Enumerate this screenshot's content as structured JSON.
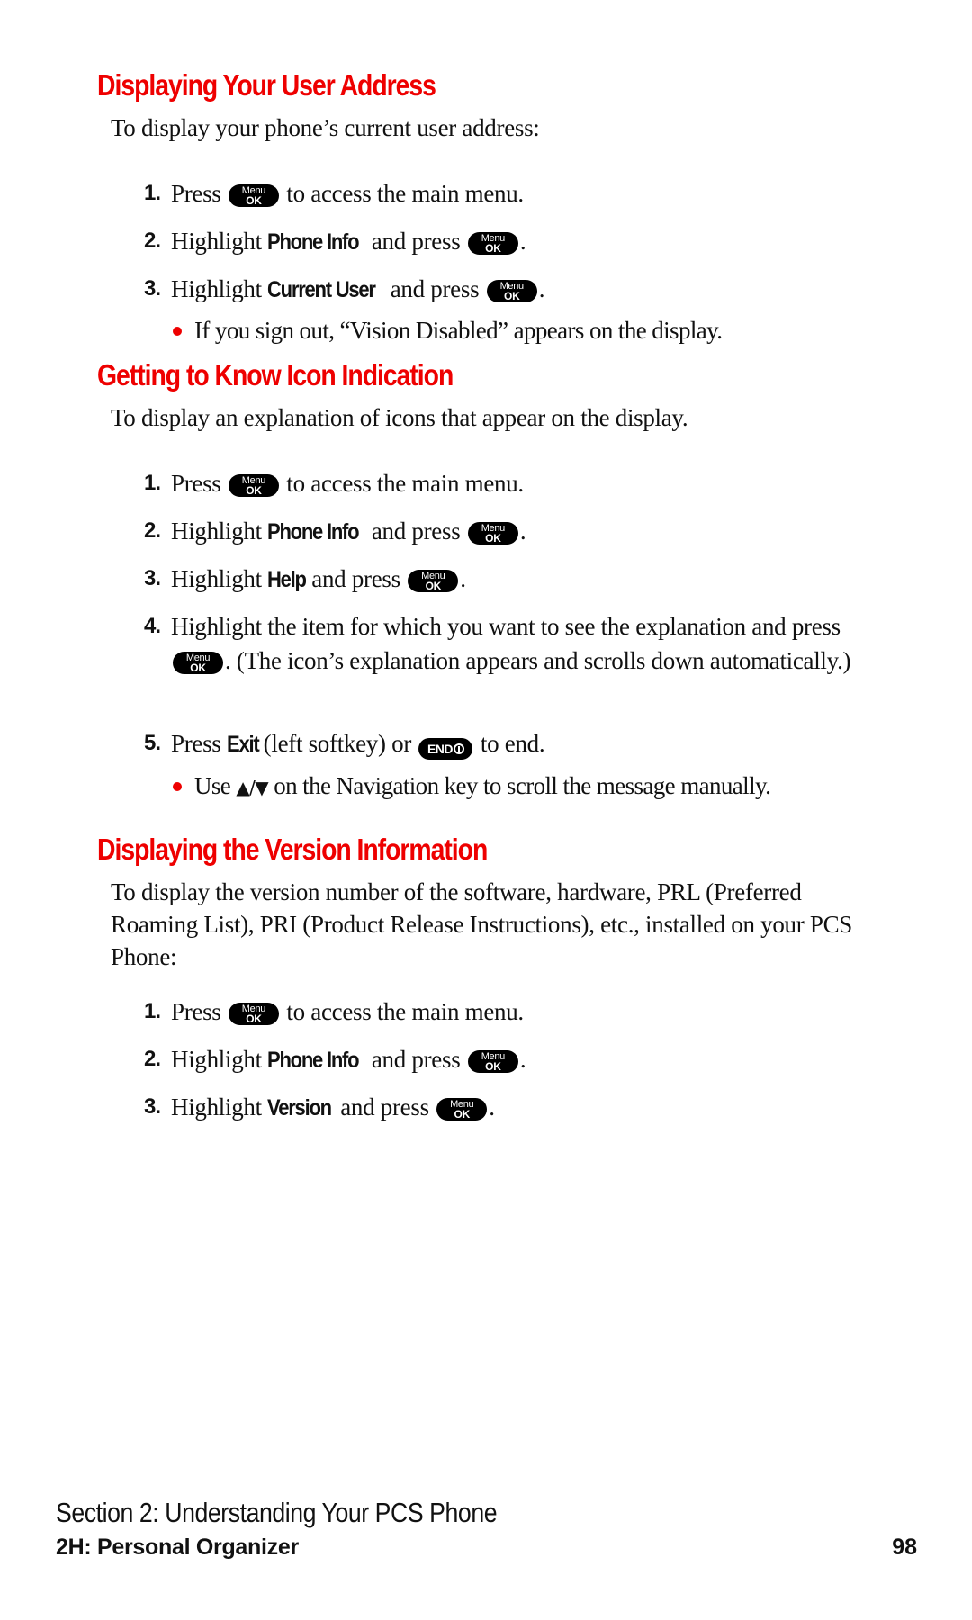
{
  "sections": [
    {
      "heading": "Displaying Your User Address",
      "intro": "To display your phone’s current user address:",
      "steps": [
        {
          "num": "1.",
          "pre": "Press",
          "key": "menu",
          "post": "to access the main menu."
        },
        {
          "num": "2.",
          "pre": "Highlight",
          "keyword": "Phone Info",
          "mid": "and press",
          "key": "menu",
          "post": "."
        },
        {
          "num": "3.",
          "pre": "Highlight",
          "keyword": "Current User",
          "mid": "and press",
          "key": "menu",
          "post": "."
        }
      ],
      "bullets": [
        "If you sign out, “Vision Disabled” appears on the display."
      ]
    },
    {
      "heading": "Getting to Know Icon Indication",
      "intro": "To display an explanation of icons that appear on the display.",
      "steps": [
        {
          "num": "1.",
          "pre": "Press",
          "key": "menu",
          "post": "to access the main menu."
        },
        {
          "num": "2.",
          "pre": "Highlight",
          "keyword": "Phone Info",
          "mid": "and press",
          "key": "menu",
          "post": "."
        },
        {
          "num": "3.",
          "pre": "Highlight",
          "keyword": "Help",
          "mid": "and press",
          "key": "menu",
          "post": "."
        },
        {
          "num": "4.",
          "pre": "Highlight the item for which you want to see the explanation and press",
          "key": "menu",
          "post": ". (The icon’s explanation appears and scrolls down automatically.)"
        },
        {
          "num": "5.",
          "pre": "Press",
          "keyword": "Exit",
          "mid": "(left softkey) or",
          "key": "end",
          "post": "to end."
        }
      ],
      "bullets": [
        {
          "pre": "Use",
          "arrows": "▲/▼",
          "post": "on the Navigation key to scroll the message manually."
        }
      ]
    },
    {
      "heading": "Displaying the Version Information",
      "intro": "To display the version number of the software, hardware, PRL (Preferred Roaming List), PRI (Product Release Instructions), etc., installed on your PCS Phone:",
      "steps": [
        {
          "num": "1.",
          "pre": "Press",
          "key": "menu",
          "post": "to access the main menu."
        },
        {
          "num": "2.",
          "pre": "Highlight",
          "keyword": "Phone Info",
          "mid": "and press",
          "key": "menu",
          "post": "."
        },
        {
          "num": "3.",
          "pre": "Highlight",
          "keyword": "Version",
          "mid": "and press",
          "key": "menu",
          "post": "."
        }
      ]
    }
  ],
  "keys": {
    "menu": {
      "top": "Menu",
      "bottom": "OK",
      "icon": "menu-ok-key-icon"
    },
    "end": {
      "label": "END",
      "icon": "end-power-key-icon"
    }
  },
  "footer": {
    "section": "Section 2: Understanding Your PCS Phone",
    "chapter": "2H: Personal Organizer",
    "page_number": "98"
  },
  "colors": {
    "heading": "#ee0000",
    "bullet": "#ee0000",
    "text": "#111111"
  }
}
